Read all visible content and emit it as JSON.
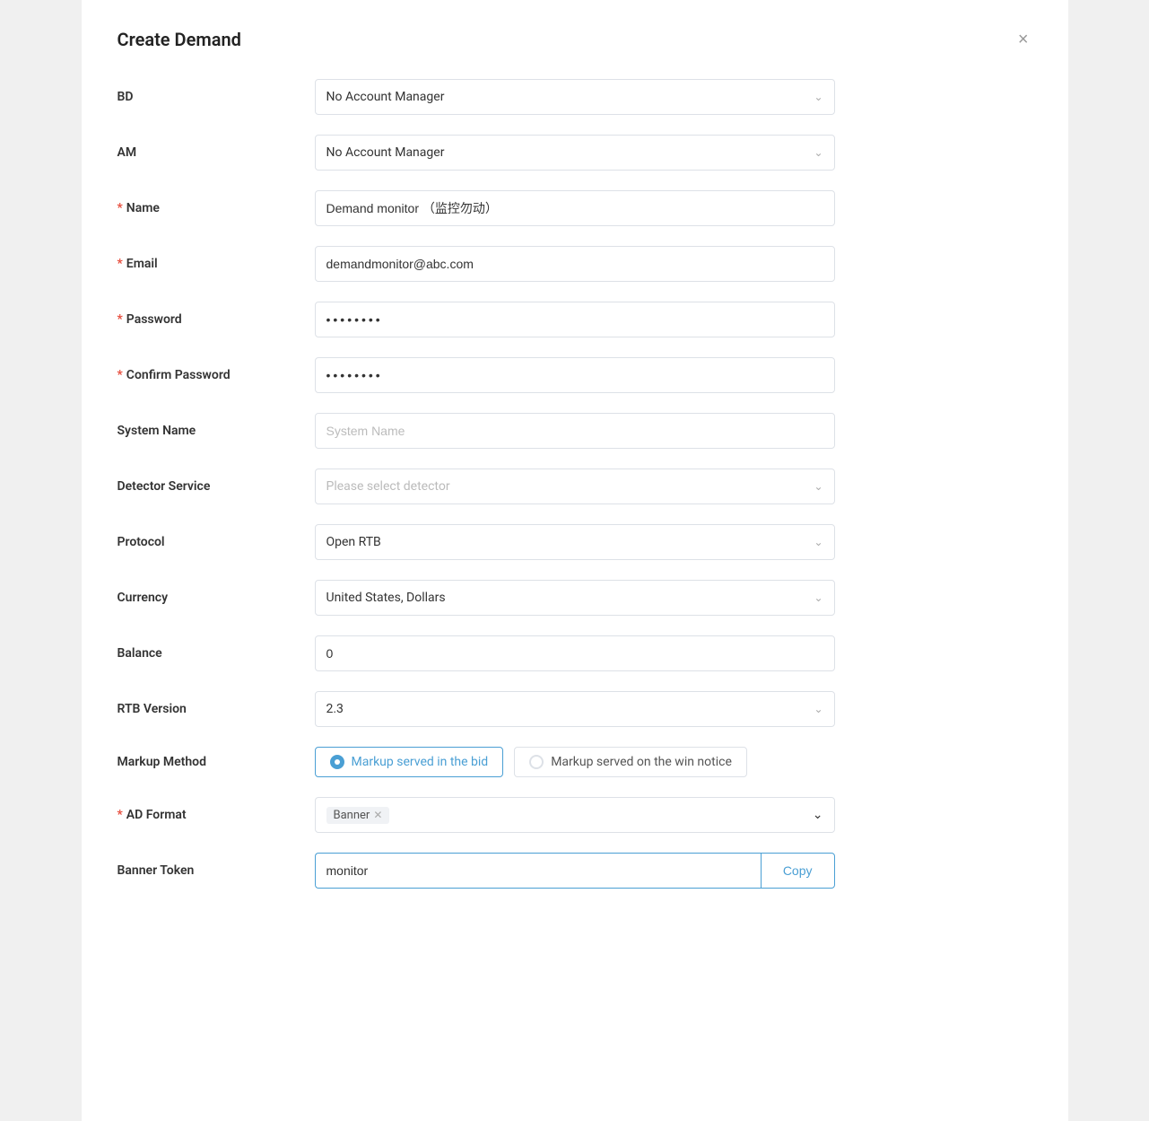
{
  "modal": {
    "title": "Create Demand",
    "close_label": "×"
  },
  "form": {
    "bd": {
      "label": "BD",
      "value": "No Account Manager",
      "required": false
    },
    "am": {
      "label": "AM",
      "value": "No Account Manager",
      "required": false
    },
    "name": {
      "label": "Name",
      "value": "Demand monitor （监控勿动）",
      "required": true,
      "placeholder": ""
    },
    "email": {
      "label": "Email",
      "value": "demandmonitor@abc.com",
      "required": true,
      "placeholder": ""
    },
    "password": {
      "label": "Password",
      "value": "••••••••",
      "required": true,
      "placeholder": ""
    },
    "confirm_password": {
      "label": "Confirm Password",
      "value": "••••••••",
      "required": true,
      "placeholder": ""
    },
    "system_name": {
      "label": "System Name",
      "value": "",
      "required": false,
      "placeholder": "System Name"
    },
    "detector_service": {
      "label": "Detector Service",
      "value": "",
      "required": false,
      "placeholder": "Please select detector"
    },
    "protocol": {
      "label": "Protocol",
      "value": "Open RTB",
      "required": false
    },
    "currency": {
      "label": "Currency",
      "value": "United States, Dollars",
      "required": false
    },
    "balance": {
      "label": "Balance",
      "value": "0",
      "required": false,
      "placeholder": ""
    },
    "rtb_version": {
      "label": "RTB Version",
      "value": "2.3",
      "required": false
    },
    "markup_method": {
      "label": "Markup Method",
      "required": false,
      "options": [
        {
          "value": "bid",
          "label": "Markup served in the bid",
          "selected": true
        },
        {
          "value": "win",
          "label": "Markup served on the win notice",
          "selected": false
        }
      ]
    },
    "ad_format": {
      "label": "AD Format",
      "required": true,
      "tag": "Banner"
    },
    "banner_token": {
      "label": "Banner Token",
      "required": false,
      "value": "monitor",
      "copy_label": "Copy"
    }
  },
  "icons": {
    "chevron": "⌄",
    "close": "×",
    "tag_close": "✕"
  }
}
